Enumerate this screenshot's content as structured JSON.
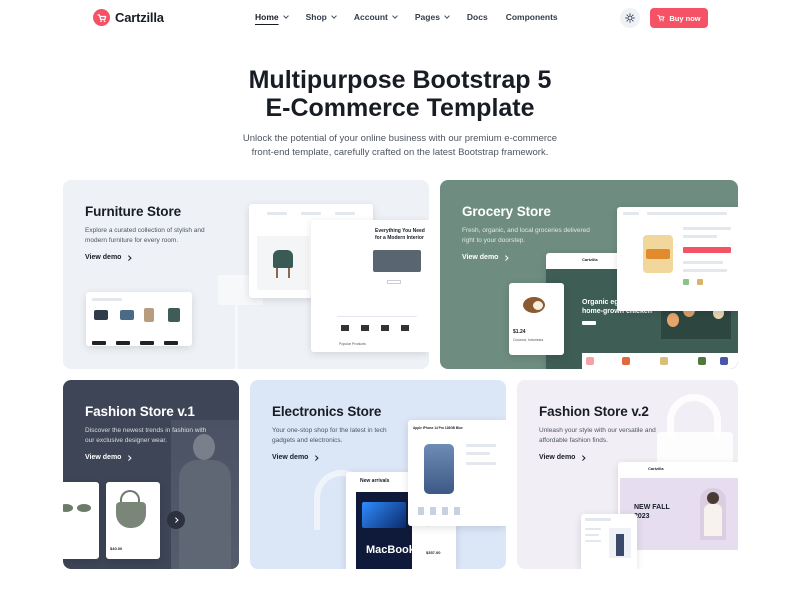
{
  "brand": {
    "name": "Cartzilla",
    "accent": "#f55266"
  },
  "nav": {
    "items": [
      {
        "label": "Home",
        "has_dropdown": true,
        "active": true
      },
      {
        "label": "Shop",
        "has_dropdown": true
      },
      {
        "label": "Account",
        "has_dropdown": true
      },
      {
        "label": "Pages",
        "has_dropdown": true
      },
      {
        "label": "Docs",
        "has_dropdown": false
      },
      {
        "label": "Components",
        "has_dropdown": false
      }
    ],
    "theme_icon": "sun-icon",
    "buy_label": "Buy now",
    "buy_icon": "cart-icon"
  },
  "hero": {
    "title_line1": "Multipurpose Bootstrap 5",
    "title_line2": "E-Commerce Template",
    "subtitle": "Unlock the potential of your online business with our premium e-commerce front-end template, carefully crafted on the latest Bootstrap framework."
  },
  "cards": [
    {
      "title": "Furniture Store",
      "desc": "Explore a curated collection of stylish and modern furniture for every room.",
      "link": "View demo",
      "bg": "#eef1f6",
      "mock": {
        "headline": "Everything You Need for a Modern Interior",
        "caption": "Popular Products"
      }
    },
    {
      "title": "Grocery Store",
      "desc": "Fresh, organic, and local groceries delivered right to your doorstep.",
      "link": "View demo",
      "bg": "#6e8c80",
      "mock": {
        "brand": "Cartzilla",
        "promo": "Organic eggs from home-grown chicken",
        "price": "$1.24",
        "product": "Coconut, Indonesia"
      }
    },
    {
      "title": "Fashion Store v.1",
      "desc": "Discover the newest trends in fashion with our exclusive designer wear.",
      "link": "View demo",
      "bg": "#3d4556",
      "mock": {
        "price": "$40.00"
      }
    },
    {
      "title": "Electronics Store",
      "desc": "Your one-stop shop for the latest in tech gadgets and electronics.",
      "link": "View demo",
      "bg": "#dbe6f7",
      "mock": {
        "section": "New arrivals",
        "laptop": "MacBook",
        "product_title": "Apple iPhone 14 Pro 128GB Blue",
        "prices": [
          "$340.99",
          "$357.00"
        ]
      }
    },
    {
      "title": "Fashion Store v.2",
      "desc": "Unleash your style with our versatile and affordable fashion finds.",
      "link": "View demo",
      "bg": "#f2eef5",
      "mock": {
        "brand": "Cartzilla",
        "banner": "NEW FALL 2023"
      }
    }
  ]
}
